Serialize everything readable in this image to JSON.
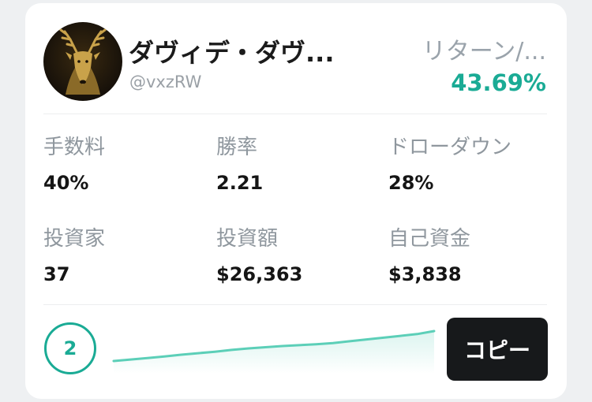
{
  "trader": {
    "name": "ダヴィデ・ダヴ...",
    "handle": "@vxzRW",
    "avatar_icon": "stag-head-icon",
    "return_label": "リターン/...",
    "return_value": "43.69%"
  },
  "stats": [
    {
      "label": "手数料",
      "value": "40%"
    },
    {
      "label": "勝率",
      "value": "2.21"
    },
    {
      "label": "ドローダウン",
      "value": "28%"
    },
    {
      "label": "投資家",
      "value": "37"
    },
    {
      "label": "投資額",
      "value": "$26,363"
    },
    {
      "label": "自己資金",
      "value": "$3,838"
    }
  ],
  "rank": "2",
  "copy_button": "コピー",
  "colors": {
    "accent": "#1aab95",
    "button_bg": "#17191b",
    "avatar_gold": "#c9a24a"
  },
  "chart_data": {
    "type": "area",
    "values": [
      0.0,
      0.05,
      0.1,
      0.15,
      0.21,
      0.26,
      0.31,
      0.37,
      0.42,
      0.46,
      0.5,
      0.53,
      0.56,
      0.6,
      0.66,
      0.72,
      0.78,
      0.84,
      0.9,
      1.0
    ],
    "title": "",
    "xlabel": "",
    "ylabel": ""
  }
}
